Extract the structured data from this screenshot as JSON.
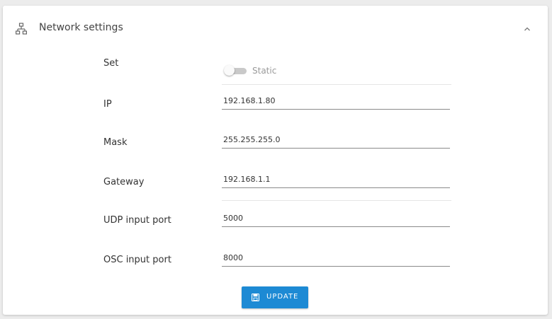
{
  "header": {
    "title": "Network settings",
    "icon": "network-icon",
    "collapse_icon": "chevron-up-icon"
  },
  "form": {
    "set": {
      "label": "Set",
      "toggle_text": "Static",
      "toggle_on": false
    },
    "ip": {
      "label": "IP",
      "value": "192.168.1.80"
    },
    "mask": {
      "label": "Mask",
      "value": "255.255.255.0"
    },
    "gateway": {
      "label": "Gateway",
      "value": "192.168.1.1"
    },
    "udp_port": {
      "label": "UDP input port",
      "value": "5000"
    },
    "osc_port": {
      "label": "OSC input port",
      "value": "8000"
    }
  },
  "update_button": {
    "label": "UPDATE",
    "icon": "save-icon"
  },
  "colors": {
    "accent": "#1d8ad4",
    "background": "#ececec",
    "panel": "#ffffff"
  }
}
